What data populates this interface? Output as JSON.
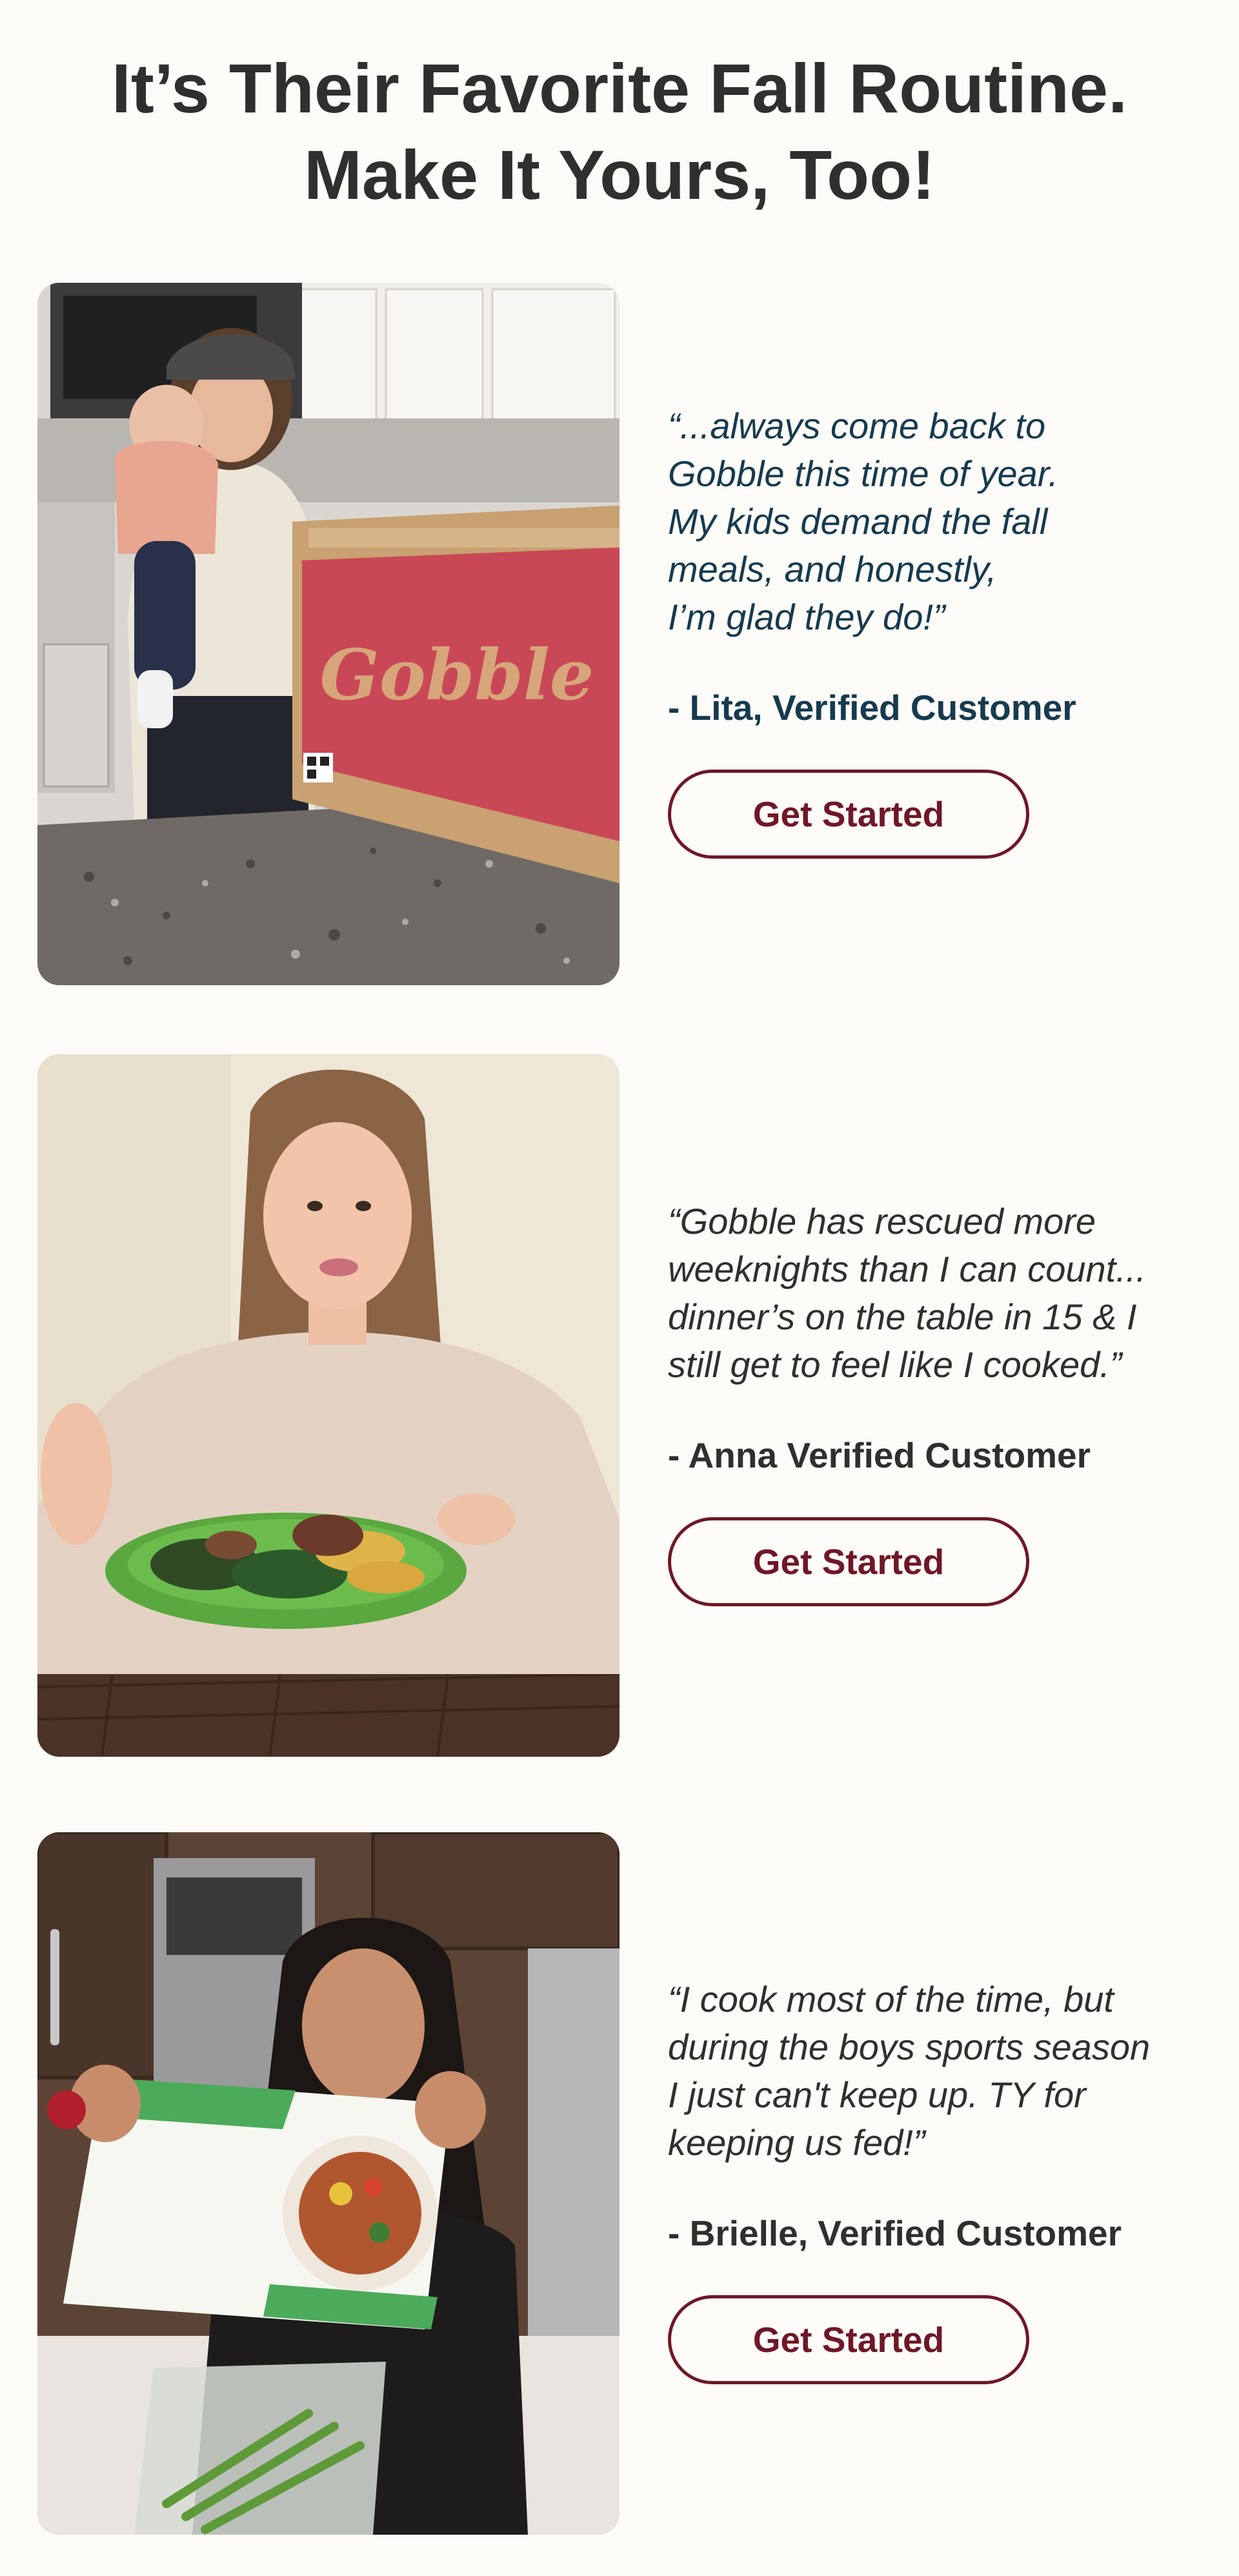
{
  "headline": {
    "line1": "It’s Their Favorite Fall Routine.",
    "line2": "Make It Yours, Too!"
  },
  "testimonials": [
    {
      "quote_lines": [
        "“...always come back to",
        "Gobble this time of year.",
        "My kids demand the fall",
        "meals, and honestly,",
        "I’m glad they do!”"
      ],
      "attribution": "- Lita, Verified Customer",
      "cta_label": "Get Started",
      "photo": {
        "box_label": "Gobble"
      }
    },
    {
      "quote_lines": [
        "“Gobble has rescued more",
        "weeknights than I can count...",
        "dinner’s on the table in 15 & I",
        "still get to feel like I cooked.”"
      ],
      "attribution": "- Anna Verified Customer",
      "cta_label": "Get Started"
    },
    {
      "quote_lines": [
        "“I cook most of the time, but",
        "during the boys sports season",
        "I just can't keep up. TY for",
        "keeping us fed!”"
      ],
      "attribution": "- Brielle, Verified Customer",
      "cta_label": "Get Started"
    }
  ],
  "colors": {
    "background": "#fcfbf8",
    "heading_text": "#2f2f2f",
    "quote_text_first": "#163a4f",
    "button_accent": "#6f1726",
    "box_red": "#c94857"
  }
}
